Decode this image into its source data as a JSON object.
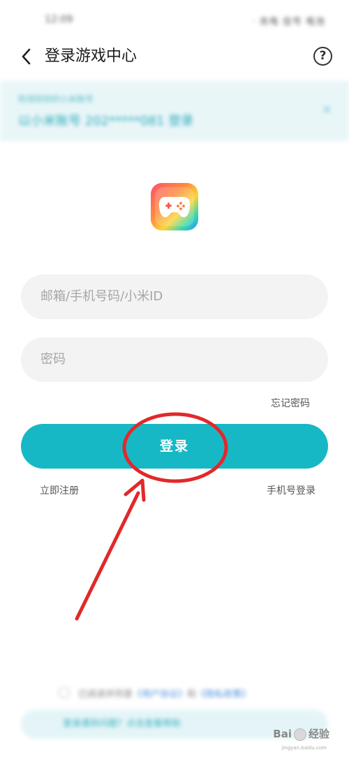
{
  "status_bar": {
    "time": "12:09",
    "icons": "· 充电 信号 电池"
  },
  "header": {
    "title": "登录游戏中心",
    "help_label": "?"
  },
  "banner": {
    "subtitle": "检测到你的小米账号",
    "text": "以小米账号 202*****081 登录",
    "close_label": "×"
  },
  "form": {
    "email_placeholder": "邮箱/手机号码/小米ID",
    "password_placeholder": "密码",
    "forgot_label": "忘记密码",
    "login_label": "登录",
    "register_label": "立即注册",
    "phone_login_label": "手机号登录"
  },
  "footer": {
    "agreement_prefix": "已阅读并同意",
    "agreement_link1": "《用户协议》",
    "agreement_link2": "《隐私政策》",
    "help_text": "登录遇到问题？点击查看帮助"
  },
  "watermark": {
    "left": "Bai",
    "right": "经验",
    "sub": "jingyan.baidu.com"
  },
  "colors": {
    "accent": "#17b8c5",
    "annotation": "#e2282b"
  }
}
